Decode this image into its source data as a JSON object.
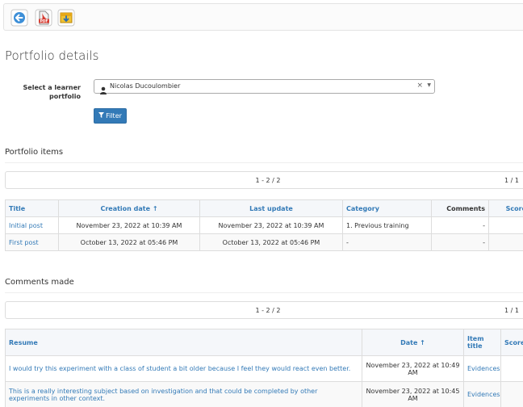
{
  "toolbar": {
    "icons": [
      "back-arrow-icon",
      "pdf-icon",
      "export-icon"
    ],
    "pdf_label": "PDF"
  },
  "page": {
    "title": "Portfolio details"
  },
  "filter_form": {
    "learner_label": "Select a learner portfolio",
    "selected_learner": "Nicolas Ducoulombier",
    "clear_symbol": "×",
    "arrow_symbol": "▼",
    "filter_button": "Filter"
  },
  "portfolio_items": {
    "title": "Portfolio items",
    "pager": {
      "range": "1 - 2 / 2",
      "pages": "1 / 1"
    },
    "columns": [
      "Title",
      "Creation date ↑",
      "Last update",
      "Category",
      "Comments",
      "Score"
    ],
    "rows": [
      {
        "title": "Initial post",
        "created": "November 23, 2022 at 10:39 AM",
        "updated": "November 23, 2022 at 10:39 AM",
        "category": "1. Previous training",
        "comments": "-",
        "score": "-"
      },
      {
        "title": "First post",
        "created": "October 13, 2022 at 05:46 PM",
        "updated": "October 13, 2022 at 05:46 PM",
        "category": "-",
        "comments": "-",
        "score": "-"
      }
    ]
  },
  "comments_made": {
    "title": "Comments made",
    "pager": {
      "range": "1 - 2 / 2",
      "pages": "1 / 1"
    },
    "columns": [
      "Resume",
      "Date ↑",
      "Item title",
      "Score"
    ],
    "rows": [
      {
        "resume": "I would try this experiment with a class of student a bit older because I feel they would react even better.",
        "date": "November 23, 2022 at 10:49 AM",
        "item_title": "Evidences",
        "score": "-"
      },
      {
        "resume": "This is a really interesting subject based on investigation and that could be completed by other experiments in other context.",
        "date": "November 23, 2022 at 10:45 AM",
        "item_title": "Evidences",
        "score": "-"
      }
    ]
  },
  "colors": {
    "link": "#337ab7",
    "button": "#337ab7",
    "header_bg": "#f5f7fa",
    "border": "#dddddd"
  }
}
